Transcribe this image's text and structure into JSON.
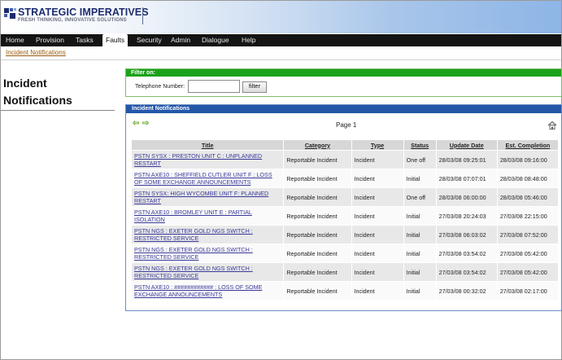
{
  "header": {
    "brand": "STRATEGIC IMPERATIVES",
    "tagline": "FRESH THINKING, INNOVATIVE SOLUTIONS"
  },
  "nav": {
    "items": [
      {
        "label": "Home"
      },
      {
        "label": "Provision"
      },
      {
        "label": "Tasks"
      },
      {
        "label": "Faults"
      },
      {
        "label": "Security"
      },
      {
        "label": "Admin"
      },
      {
        "label": "Dialogue"
      },
      {
        "label": "Help"
      }
    ],
    "active": "Faults"
  },
  "subnav": {
    "link": "Incident Notifications"
  },
  "page": {
    "title": "Incident Notifications"
  },
  "filter": {
    "heading": "Filter on:",
    "label": "Telephone Number:",
    "value": "",
    "button": "filter"
  },
  "incidents": {
    "heading": "Incident Notifications",
    "page_label": "Page 1",
    "columns": [
      "Title",
      "Category",
      "Type",
      "Status",
      "Update Date",
      "Est. Completion"
    ],
    "rows": [
      {
        "title": "PSTN SYSX : PRESTON UNIT C : UNPLANNED RESTART",
        "category": "Reportable Incident",
        "type": "Incident",
        "status": "One off",
        "update": "28/03/08 09:25:01",
        "completion": "28/03/08 09:16:00"
      },
      {
        "title": "PSTN AXE10 : SHEFFIELD CUTLER UNIT F : LOSS OF SOME EXCHANGE ANNOUNCEMENTS",
        "category": "Reportable Incident",
        "type": "Incident",
        "status": "Initial",
        "update": "28/03/08 07:07:01",
        "completion": "28/03/08 08:48:00"
      },
      {
        "title": "PSTN SYSX: HIGH WYCOMBE UNIT F: PLANNED RESTART",
        "category": "Reportable Incident",
        "type": "Incident",
        "status": "One off",
        "update": "28/03/08 06:00:00",
        "completion": "28/03/08 05:46:00"
      },
      {
        "title": "PSTN AXE10 : BROMLEY UNIT E : PARTIAL ISOLATION",
        "category": "Reportable Incident",
        "type": "Incident",
        "status": "Initial",
        "update": "27/03/08 20:24:03",
        "completion": "27/03/08 22:15:00"
      },
      {
        "title": "PSTN NGS : EXETER GOLD NGS SWITCH : RESTRICTED SERVICE",
        "category": "Reportable Incident",
        "type": "Incident",
        "status": "Initial",
        "update": "27/03/08 06:03:02",
        "completion": "27/03/08 07:52:00"
      },
      {
        "title": "PSTN NGS : EXETER GOLD NGS SWITCH : RESTRICTED SERVICE",
        "category": "Reportable Incident",
        "type": "Incident",
        "status": "Initial",
        "update": "27/03/08 03:54:02",
        "completion": "27/03/08 05:42:00"
      },
      {
        "title": "PSTN NGS : EXETER GOLD NGS SWITCH : RESTRICTED SERVICE",
        "category": "Reportable Incident",
        "type": "Incident",
        "status": "Initial",
        "update": "27/03/08 03:54:02",
        "completion": "27/03/08 05:42:00"
      },
      {
        "title": "PSTN AXE10 : ############ : LOSS OF SOME EXCHANGE ANNOUNCEMENTS",
        "category": "Reportable Incident",
        "type": "Incident",
        "status": "Initial",
        "update": "27/03/08 00:32:02",
        "completion": "27/03/08 02:17:00"
      }
    ]
  },
  "icons": {
    "logo": "logo-squares-icon",
    "prev": "arrow-left-icon",
    "next": "arrow-right-icon",
    "home": "home-icon"
  },
  "colors": {
    "brand": "#1d2c6e",
    "nav_bg": "#141414",
    "filter_head": "#1aa21a",
    "incident_head": "#2456a8",
    "link": "#3a3a9a"
  }
}
